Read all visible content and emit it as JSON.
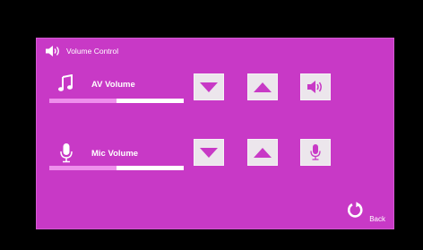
{
  "header": {
    "icon": "speaker-icon",
    "title": "Volume Control"
  },
  "av": {
    "icon": "music-note-icon",
    "label": "AV Volume",
    "level": 0.5,
    "buttons": {
      "down": "volume-down",
      "up": "volume-up",
      "mute": "speaker-icon"
    }
  },
  "mic": {
    "icon": "microphone-icon",
    "label": "Mic Volume",
    "level": 0.5,
    "buttons": {
      "down": "volume-down",
      "up": "volume-up",
      "mute": "microphone-icon"
    }
  },
  "back": {
    "icon": "refresh-arrow-icon",
    "label": "Back"
  },
  "colors": {
    "background": "#000000",
    "panel": "#c839c6",
    "button": "#ece6ec",
    "arrow": "#c839c6",
    "bar_track": "#ffffff",
    "bar_fill": "#ee8fec",
    "text": "#ffffff"
  }
}
